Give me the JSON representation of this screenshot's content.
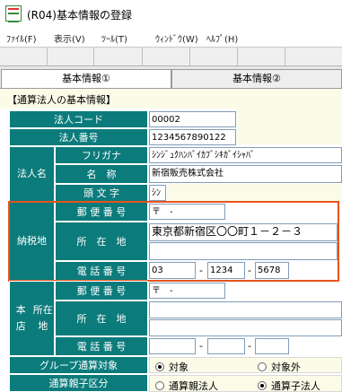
{
  "window": {
    "title": "(R04)基本情報の登録"
  },
  "menu": [
    {
      "label": "ﾌｧｲﾙ(F)"
    },
    {
      "label": "表示(V)"
    },
    {
      "label": "ﾂｰﾙ(T)"
    },
    {
      "label": "ｳｨﾝﾄﾞｳ(W)"
    },
    {
      "label": "ﾍﾙﾌﾟ(H)"
    }
  ],
  "tabs": [
    {
      "label": "基本情報①",
      "active": true
    },
    {
      "label": "基本情報②",
      "active": false
    }
  ],
  "section_title": "【通算法人の基本情報】",
  "labels": {
    "corp_code": "法人コード",
    "corp_number": "法人番号",
    "corp_name_group": "法人名",
    "furigana": "フリガナ",
    "name": "名　称",
    "initial": "頭 文 字",
    "tax_place_group": "納税地",
    "postal": "郵 便 番 号",
    "address": "所　在　地",
    "phone": "電 話 番 号",
    "head_office_group_1": "本　店",
    "head_office_group_2": "所在地",
    "group_target": "グループ通算対象",
    "parent_child": "通算親子区分"
  },
  "values": {
    "corp_code": "00002",
    "corp_number": "1234567890122",
    "furigana": "ｼﾝｼﾞｭｸﾊﾝﾊﾞｲｶﾌﾞｼｷｶﾞｲｼｬﾊﾞ",
    "name": "新宿販売株式会社",
    "initial": "ｼﾝ",
    "tax_postal": "〒　-",
    "tax_address_1": "東京都新宿区〇〇町１－２－３",
    "tax_address_2": "",
    "tax_phone_1": "03",
    "tax_phone_2": "1234",
    "tax_phone_3": "5678",
    "ho_postal": "〒　-",
    "ho_address_1": "",
    "ho_address_2": "",
    "ho_phone_1": "",
    "ho_phone_2": "",
    "ho_phone_3": "",
    "dash": "-"
  },
  "group_target_options": [
    {
      "label": "対象",
      "selected": true
    },
    {
      "label": "対象外",
      "selected": false
    }
  ],
  "parent_child_options": [
    {
      "label": "通算親法人",
      "selected": false
    },
    {
      "label": "通算子法人",
      "selected": true
    }
  ],
  "colors": {
    "label_bg": "#0c7b7b",
    "highlight": "#e8541c",
    "cream": "#fbfbe8"
  }
}
